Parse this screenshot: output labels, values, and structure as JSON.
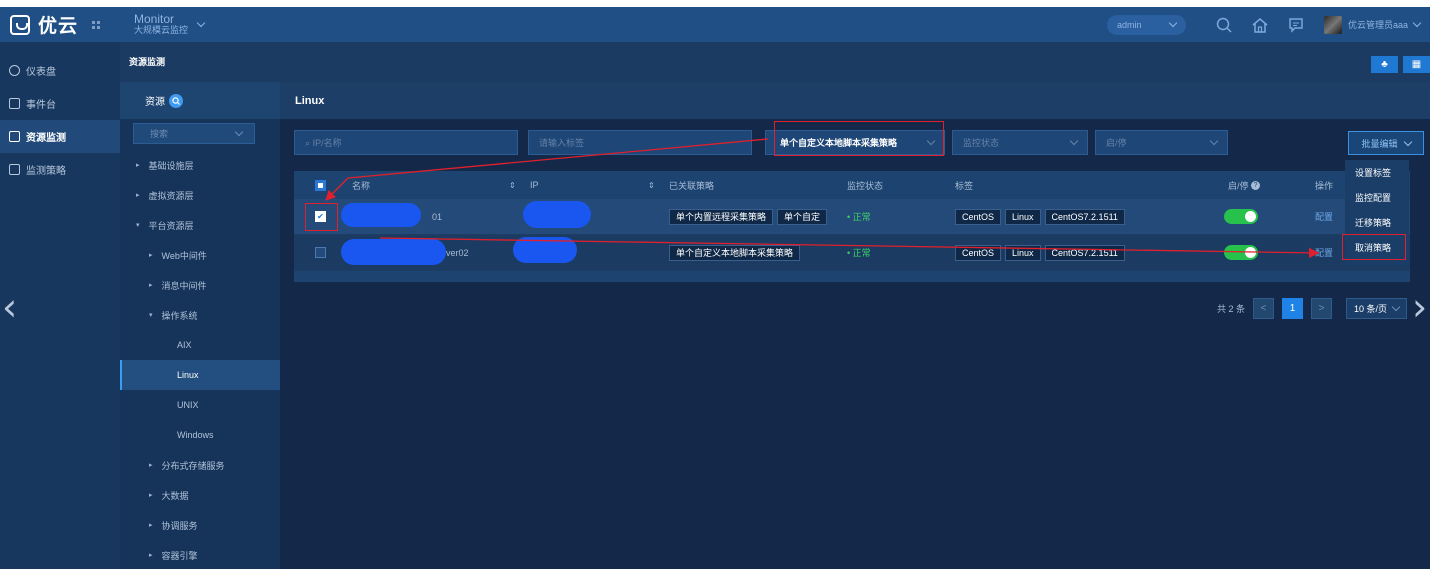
{
  "topbar": {
    "brand": "优云",
    "app_title": "Monitor",
    "app_subtitle": "大规模云监控",
    "user_select": "admin",
    "user_name": "优云管理员aaa"
  },
  "nav": [
    {
      "label": "仪表盘",
      "icon": "dashboard-icon",
      "active": false
    },
    {
      "label": "事件台",
      "icon": "event-icon",
      "active": false
    },
    {
      "label": "资源监测",
      "icon": "monitor-icon",
      "active": true
    },
    {
      "label": "监测策略",
      "icon": "strategy-icon",
      "active": false
    }
  ],
  "breadcrumb": "资源监测",
  "tree": {
    "title": "资源",
    "search_placeholder": "搜索",
    "items": [
      {
        "label": "基础设施层",
        "level": 0,
        "arrow": "▸"
      },
      {
        "label": "虚拟资源层",
        "level": 0,
        "arrow": "▸"
      },
      {
        "label": "平台资源层",
        "level": 0,
        "arrow": "▾"
      },
      {
        "label": "Web中间件",
        "level": 1,
        "arrow": "▸"
      },
      {
        "label": "消息中间件",
        "level": 1,
        "arrow": "▸"
      },
      {
        "label": "操作系统",
        "level": 1,
        "arrow": "▾"
      },
      {
        "label": "AIX",
        "level": 2,
        "arrow": ""
      },
      {
        "label": "Linux",
        "level": 2,
        "arrow": "",
        "selected": true
      },
      {
        "label": "UNIX",
        "level": 2,
        "arrow": ""
      },
      {
        "label": "Windows",
        "level": 2,
        "arrow": ""
      },
      {
        "label": "分布式存储服务",
        "level": 1,
        "arrow": "▸"
      },
      {
        "label": "大数据",
        "level": 1,
        "arrow": "▸"
      },
      {
        "label": "协调服务",
        "level": 1,
        "arrow": "▸"
      },
      {
        "label": "容器引擎",
        "level": 1,
        "arrow": "▸"
      }
    ]
  },
  "panel": {
    "title": "Linux",
    "filters": {
      "name_placeholder": "IP/名称",
      "tag_placeholder": "请输入标签",
      "strategy_value": "单个自定义本地脚本采集策略",
      "status_placeholder": "监控状态",
      "enable_placeholder": "启/停"
    },
    "bulk_edit": {
      "label": "批量编辑",
      "menu": [
        "设置标签",
        "监控配置",
        "迁移策略",
        "取消策略"
      ]
    }
  },
  "table": {
    "headers": {
      "name": "名称",
      "ip": "IP",
      "strategy": "已关联策略",
      "status": "监控状态",
      "tags": "标签",
      "enable": "启/停",
      "op": "操作"
    },
    "rows": [
      {
        "checked": true,
        "name_suffix": "01",
        "strategies": [
          "单个内置远程采集策略",
          "单个自定"
        ],
        "status": "• 正常",
        "tags": [
          "CentOS",
          "Linux",
          "CentOS7.2.1511"
        ],
        "op": "配置"
      },
      {
        "checked": false,
        "name_suffix": "ver02",
        "strategies": [
          "单个自定义本地脚本采集策略"
        ],
        "status": "• 正常",
        "tags": [
          "CentOS",
          "Linux",
          "CentOS7.2.1511"
        ],
        "op": "配置"
      }
    ]
  },
  "pager": {
    "total": "共 2 条",
    "current": "1",
    "page_size": "10 条/页"
  },
  "colors": {
    "accent": "#1f78d1",
    "status_ok": "#3ed36a",
    "annotation": "#e0202c",
    "redaction": "#1a57f0"
  }
}
